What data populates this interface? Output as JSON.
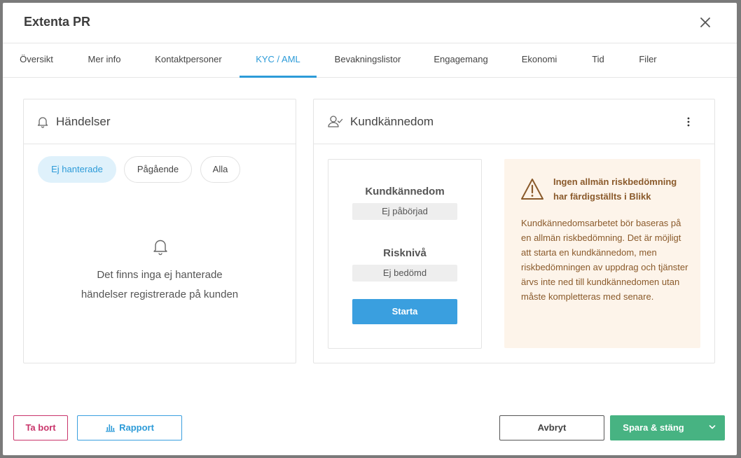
{
  "modal": {
    "title": "Extenta PR"
  },
  "tabs": [
    {
      "label": "Översikt"
    },
    {
      "label": "Mer info"
    },
    {
      "label": "Kontaktpersoner"
    },
    {
      "label": "KYC / AML",
      "active": true
    },
    {
      "label": "Bevakningslistor"
    },
    {
      "label": "Engagemang"
    },
    {
      "label": "Ekonomi"
    },
    {
      "label": "Tid"
    },
    {
      "label": "Filer"
    }
  ],
  "events": {
    "title": "Händelser",
    "filters": [
      {
        "label": "Ej hanterade",
        "active": true
      },
      {
        "label": "Pågående"
      },
      {
        "label": "Alla"
      }
    ],
    "empty_line1": "Det finns inga ej hanterade",
    "empty_line2": "händelser registrerade på kunden"
  },
  "kyc": {
    "title": "Kundkännedom",
    "status_label": "Kundkännedom",
    "status_value": "Ej påbörjad",
    "risk_label": "Risknivå",
    "risk_value": "Ej bedömd",
    "start_button": "Starta",
    "warning_title": "Ingen allmän riskbedömning har färdigställts i Blikk",
    "warning_body": "Kundkännedomsarbetet bör baseras på en allmän riskbedömning. Det är möjligt att starta en kundkännedom, men riskbedömningen av uppdrag och tjänster ärvs inte ned till kundkännedomen utan måste kompletteras med senare."
  },
  "footer": {
    "delete_label": "Ta bort",
    "report_label": "Rapport",
    "cancel_label": "Avbryt",
    "save_label": "Spara & stäng"
  },
  "colors": {
    "accent_blue": "#2d9bd8",
    "save_green": "#47b382",
    "delete_red": "#c9356b",
    "warning_bg": "#fdf4ea"
  }
}
